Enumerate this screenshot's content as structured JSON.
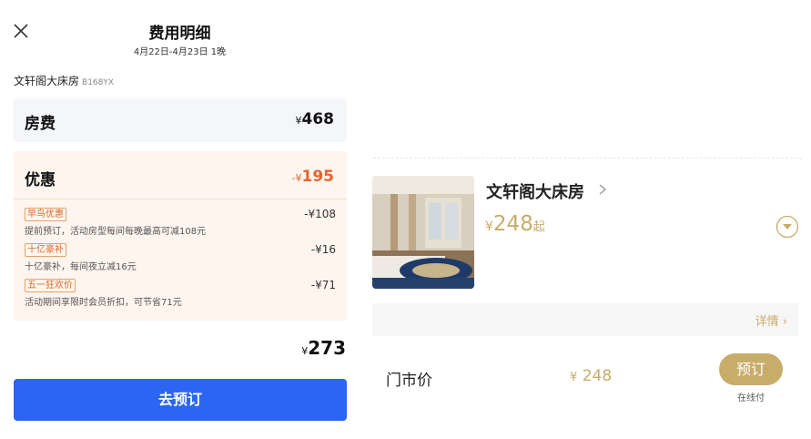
{
  "left": {
    "title": "费用明细",
    "dates": "4月22日-4月23日 1晚",
    "room_name": "文轩阁大床房",
    "room_code": "B168YX",
    "room_fee": {
      "label": "房费",
      "currency": "¥",
      "amount": "468"
    },
    "discount": {
      "label": "优惠",
      "prefix": "-",
      "currency": "¥",
      "amount": "195",
      "items": [
        {
          "tag": "早鸟优惠",
          "desc": "提前预订，活动房型每间每晚最高可减108元",
          "amount": "-¥108"
        },
        {
          "tag": "十亿豪补",
          "desc": "十亿豪补，每间夜立减16元",
          "amount": "-¥16"
        },
        {
          "tag": "五一狂欢价",
          "desc": "活动期间享限时会员折扣，可节省71元",
          "amount": "-¥71"
        }
      ]
    },
    "total": {
      "currency": "¥",
      "amount": "273"
    },
    "book_button": "去预订"
  },
  "right": {
    "hotel_name": "文轩阁大床房",
    "price": {
      "currency": "¥",
      "amount": "248",
      "suffix": "起"
    },
    "detail_link": "详情",
    "rate": {
      "name": "门市价",
      "price": "248",
      "currency": "¥",
      "button": "预订",
      "payment": "在线付"
    }
  },
  "colors": {
    "blue": "#2b66f3",
    "orange": "#e8632c",
    "gold": "#c8ac6a"
  }
}
